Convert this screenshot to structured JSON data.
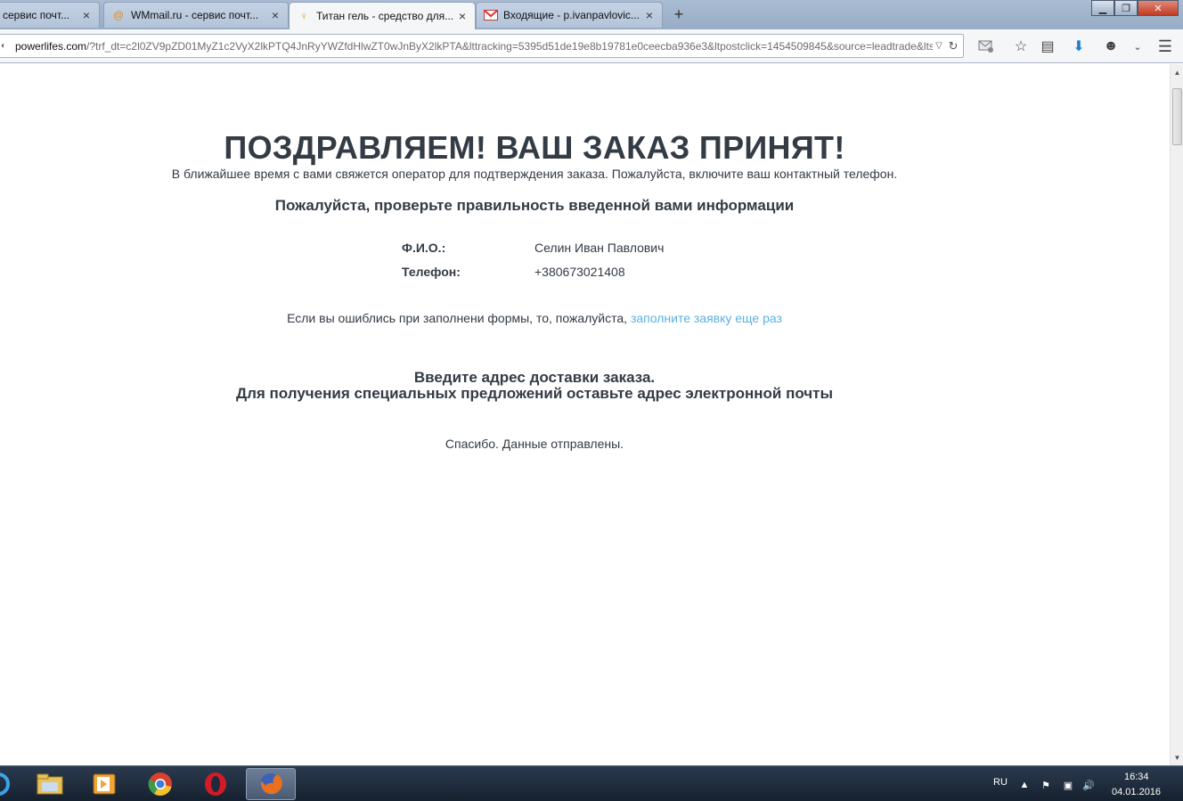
{
  "tabs": [
    {
      "title": "сервис почт...",
      "favicon": "mail-icon",
      "active": false
    },
    {
      "title": "WMmail.ru - сервис почт...",
      "favicon": "wmmail-icon",
      "active": false
    },
    {
      "title": "Титан гель - средство для...",
      "favicon": "titan-icon",
      "active": true
    },
    {
      "title": "Входящие - p.ivanpavlovic...",
      "favicon": "gmail-icon",
      "active": false
    }
  ],
  "address_bar": {
    "host": "powerlifes.com",
    "path": "/?trf_dt=c2l0ZV9pZD01MyZ1c2VyX2lkPTQ4JnRyYWZfdHlwZT0wJnByX2lkPTA&lttracking=5395d51de19e8b19781e0ceecba936e3&ltpostclick=1454509845&source=leadtrade&ltsourc"
  },
  "page": {
    "headline": "ПОЗДРАВЛЯЕМ! ВАШ ЗАКАЗ ПРИНЯТ!",
    "subline": "В ближайшее время с вами свяжется оператор для подтверждения заказа. Пожалуйста, включите ваш контактный телефон.",
    "check_heading": "Пожалуйста, проверьте правильность введенной вами информации",
    "name_label": "Ф.И.О.:",
    "name_value": "Селин Иван Павлович",
    "phone_label": "Телефон:",
    "phone_value": "+380673021408",
    "error_text": "Если вы ошиблись при заполнени формы, то, пожалуйста, ",
    "error_link": "заполните заявку еще раз",
    "address_heading_1": "Введите адрес доставки заказа.",
    "address_heading_2": "Для получения специальных предложений оставьте адрес электронной почты",
    "thanks": "Спасибо. Данные отправлены."
  },
  "taskbar": {
    "language": "RU",
    "time": "16:34",
    "date": "04.01.2016"
  },
  "colors": {
    "text": "#333b44",
    "link": "#5ab0e0",
    "tabbar": "#a9bcd3",
    "taskbar": "#1d2a3a"
  }
}
